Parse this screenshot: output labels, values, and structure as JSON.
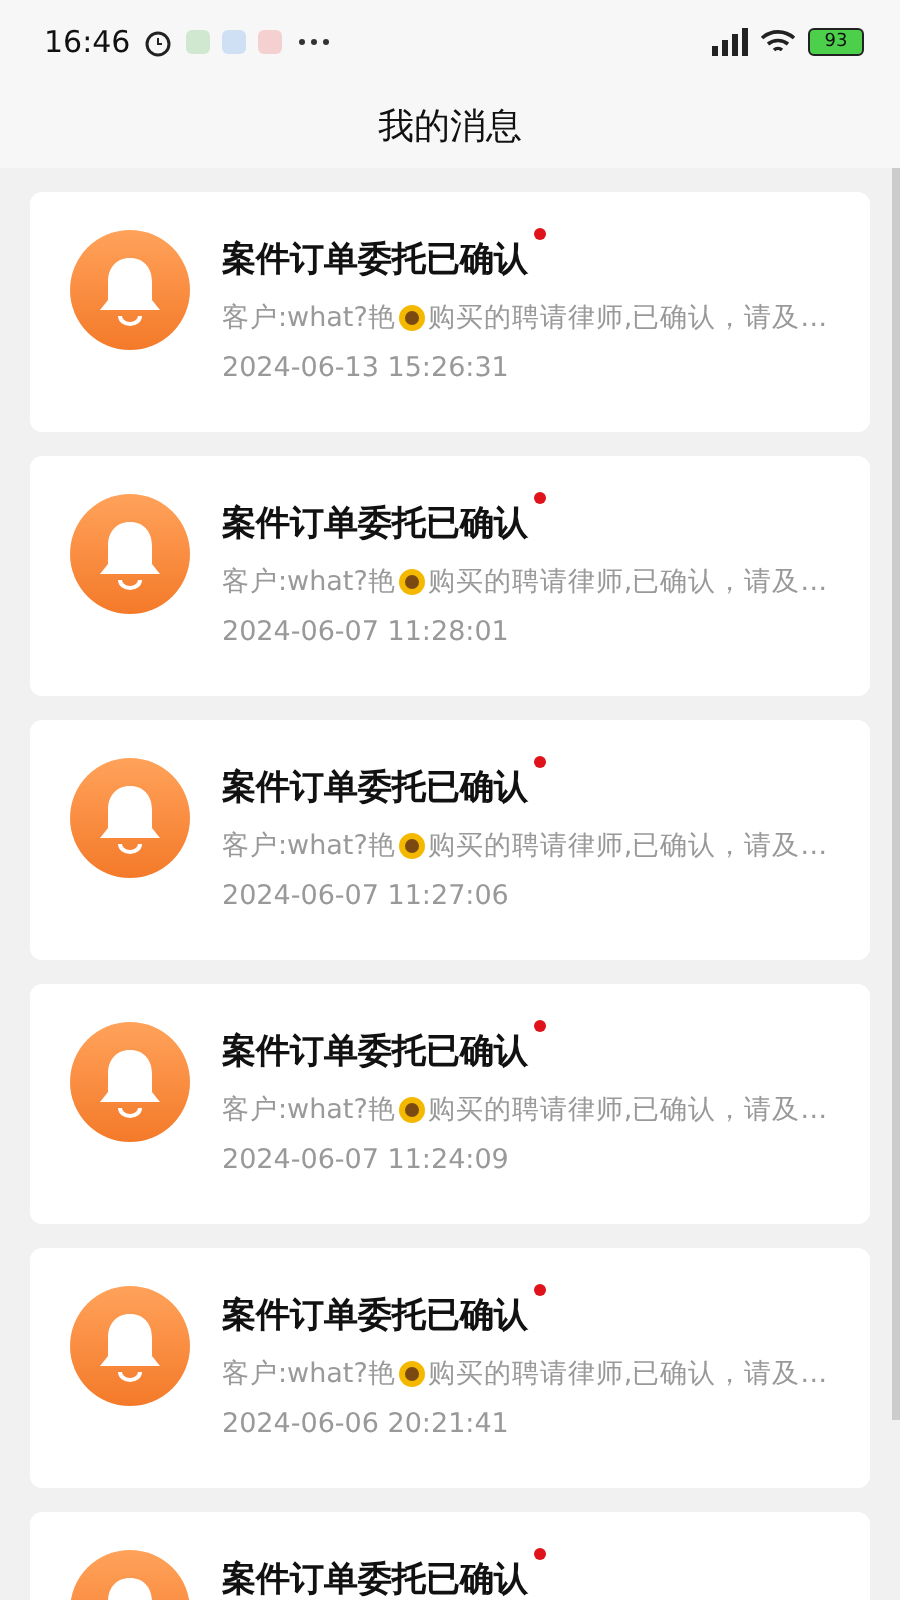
{
  "status_bar": {
    "time": "16:46",
    "battery": "93"
  },
  "header": {
    "title": "我的消息"
  },
  "messages": [
    {
      "title": "案件订单委托已确认",
      "unread": true,
      "preview_before": "客户:what?艳",
      "preview_after": "购买的聘请律师,已确认，请及…",
      "time": "2024-06-13 15:26:31"
    },
    {
      "title": "案件订单委托已确认",
      "unread": true,
      "preview_before": "客户:what?艳",
      "preview_after": "购买的聘请律师,已确认，请及…",
      "time": "2024-06-07 11:28:01"
    },
    {
      "title": "案件订单委托已确认",
      "unread": true,
      "preview_before": "客户:what?艳",
      "preview_after": "购买的聘请律师,已确认，请及…",
      "time": "2024-06-07 11:27:06"
    },
    {
      "title": "案件订单委托已确认",
      "unread": true,
      "preview_before": "客户:what?艳",
      "preview_after": "购买的聘请律师,已确认，请及…",
      "time": "2024-06-07 11:24:09"
    },
    {
      "title": "案件订单委托已确认",
      "unread": true,
      "preview_before": "客户:what?艳",
      "preview_after": "购买的聘请律师,已确认，请及…",
      "time": "2024-06-06 20:21:41"
    },
    {
      "title": "案件订单委托已确认",
      "unread": true
    }
  ]
}
